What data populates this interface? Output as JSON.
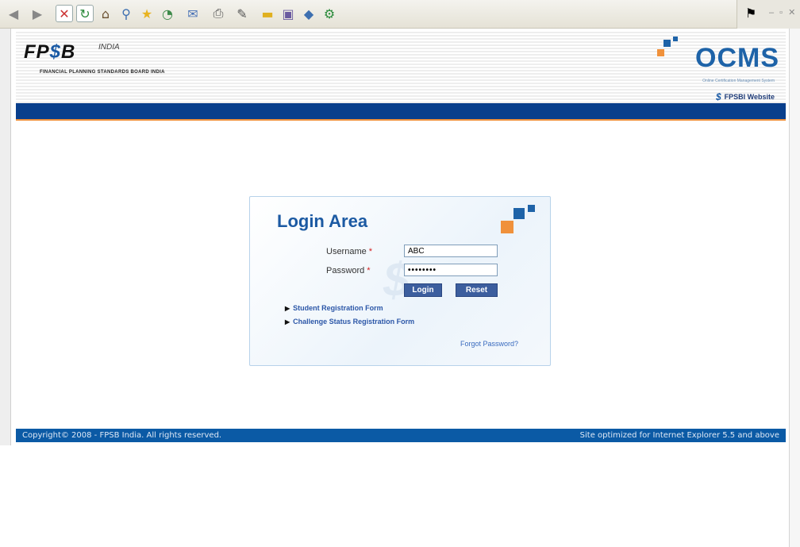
{
  "browser": {
    "toolbar_icons": [
      "back-icon",
      "forward-icon",
      "stop-icon",
      "refresh-icon",
      "home-icon",
      "search-icon",
      "favorites-icon",
      "history-icon",
      "mail-icon",
      "print-icon",
      "edit-icon",
      "folder-icon",
      "discuss-icon",
      "messenger-icon",
      "tools-icon"
    ]
  },
  "header": {
    "logo_text": "FPSB",
    "logo_region": "INDIA",
    "logo_subtitle": "FINANCIAL PLANNING STANDARDS BOARD INDIA",
    "ocms_logo": "OCMS",
    "ocms_subtitle": "Online Certification Management System",
    "website_link": "FPSBI Website"
  },
  "login": {
    "title": "Login Area",
    "username_label": "Username",
    "username_value": "ABC",
    "password_label": "Password",
    "password_value": "••••••••",
    "required_mark": "*",
    "login_button": "Login",
    "reset_button": "Reset",
    "links": [
      "Student Registration Form",
      "Challenge Status Registration Form"
    ],
    "forgot_password": "Forgot Password?"
  },
  "footer": {
    "copyright": "Copyright© 2008 - FPSB India. All rights reserved.",
    "optimized": "Site optimized for Internet Explorer 5.5 and above"
  },
  "colors": {
    "brand_blue": "#093f8c",
    "accent_orange": "#f0913b",
    "title_blue": "#1c5aa3"
  }
}
